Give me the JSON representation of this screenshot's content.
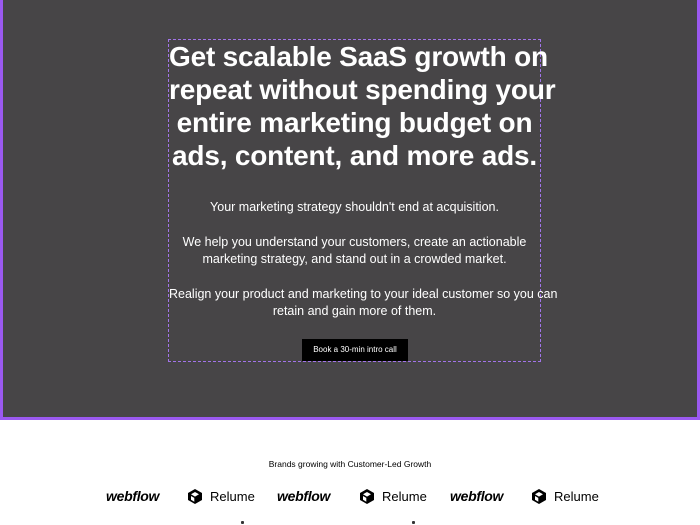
{
  "hero": {
    "title_lines": [
      "Get scalable SaaS growth on",
      "repeat without spending your",
      "entire marketing budget on",
      "ads, content, and more ads."
    ],
    "paragraph1_lines": [
      "Your marketing strategy shouldn't end at acquisition."
    ],
    "paragraph2_lines": [
      "We help you understand your customers, create an actionable",
      "marketing strategy, and stand out in a crowded market."
    ],
    "paragraph3_lines": [
      "Realign your product and marketing to your ideal customer so you can",
      "retain and gain more of them."
    ],
    "cta_label": "Book a 30-min intro call"
  },
  "brands": {
    "caption": "Brands growing with Customer-Led Growth",
    "logos": [
      {
        "name": "webflow",
        "icon": "none"
      },
      {
        "name": "Relume",
        "icon": "cube-icon"
      },
      {
        "name": "webflow",
        "icon": "none"
      },
      {
        "name": "Relume",
        "icon": "cube-icon"
      },
      {
        "name": "webflow",
        "icon": "none"
      },
      {
        "name": "Relume",
        "icon": "cube-icon"
      }
    ]
  },
  "colors": {
    "hero_background": "#474547",
    "hero_border": "#9b59f0",
    "cta_background": "#000000",
    "text_on_dark": "#ffffff"
  }
}
